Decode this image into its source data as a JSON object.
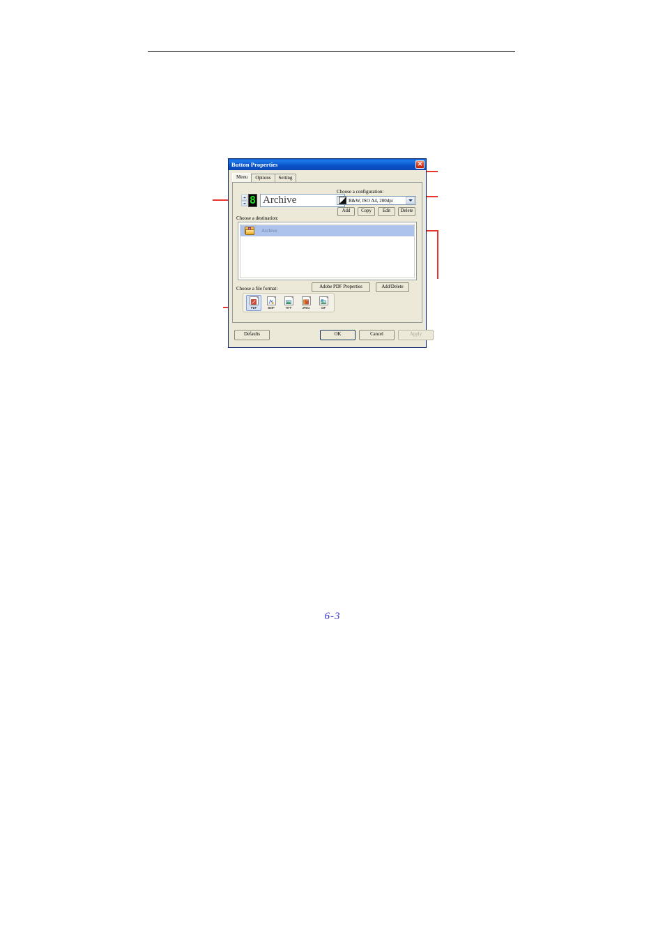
{
  "page": {
    "page_number": "6-3"
  },
  "dialog": {
    "title": "Button Properties",
    "close_icon": "close-x-icon",
    "tabs": [
      {
        "label": "Menu",
        "active": true
      },
      {
        "label": "Options",
        "active": false
      },
      {
        "label": "Setting",
        "active": false
      }
    ],
    "button_number": {
      "display_value": "8",
      "spinner_up_icon": "spin-up-arrow-icon",
      "spinner_down_icon": "spin-down-arrow-icon"
    },
    "button_name": {
      "value": "Archive"
    },
    "configuration": {
      "label": "Choose a configuration:",
      "selected": "B&W, ISO A4, 200dpi",
      "swatch_icon": "bw-mode-icon",
      "dropdown_icon": "chevron-down-icon",
      "buttons": [
        {
          "label": "Add"
        },
        {
          "label": "Copy"
        },
        {
          "label": "Edit"
        },
        {
          "label": "Delete"
        }
      ]
    },
    "destination": {
      "label": "Choose a destination:",
      "items": [
        {
          "label": "Archive",
          "icon": "folder-icon",
          "selected": true
        }
      ]
    },
    "file_format": {
      "label": "Choose a file format:",
      "pdf_properties_button": "Adobe PDF Properties",
      "add_delete_button": "Add/Delete",
      "formats": [
        {
          "label": "PDF",
          "icon": "pdf-file-icon",
          "color": "#d44a3a",
          "selected": true
        },
        {
          "label": "BMP",
          "icon": "bmp-file-icon",
          "color": "#3f7bbf",
          "selected": false
        },
        {
          "label": "TIFF",
          "icon": "tiff-file-icon",
          "color": "#3f9a4e",
          "selected": false
        },
        {
          "label": "JPEG",
          "icon": "jpeg-file-icon",
          "color": "#e08a20",
          "selected": false
        },
        {
          "label": "GIF",
          "icon": "gif-file-icon",
          "color": "#4aa6c8",
          "selected": false
        }
      ]
    },
    "actions": {
      "defaults": "Defaults",
      "ok": "OK",
      "cancel": "Cancel",
      "apply": "Apply"
    }
  },
  "colors": {
    "titlebar": "#0a52c8",
    "dialog_face": "#ece9d8",
    "selection": "#aec3ec",
    "annotation": "#e8352c",
    "page_number": "#3333cc"
  }
}
